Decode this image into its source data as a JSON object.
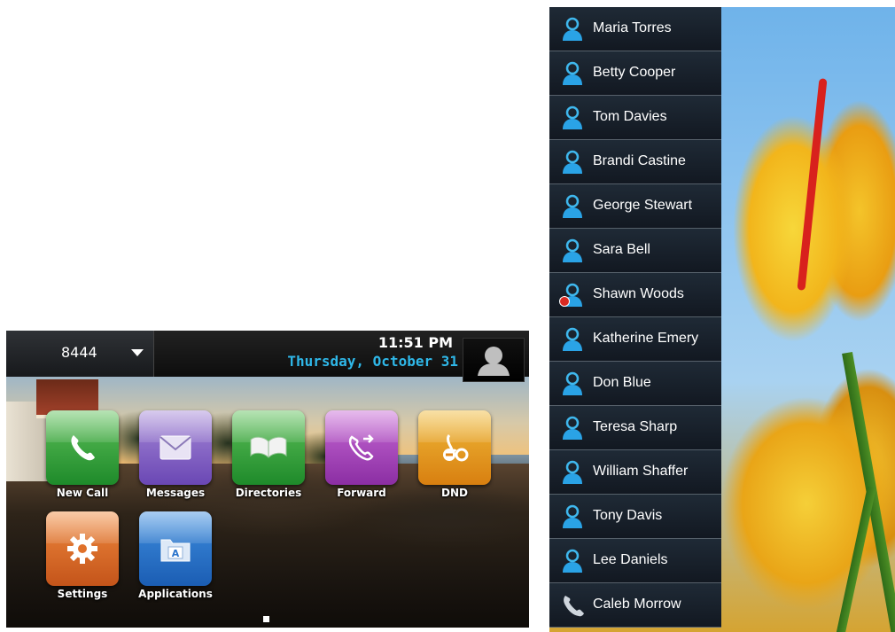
{
  "home": {
    "line": "8444",
    "time": "11:51 PM",
    "date": "Thursday, October 31",
    "apps": [
      {
        "label": "New Call",
        "icon": "phone-icon",
        "color": "#2e9b35"
      },
      {
        "label": "Messages",
        "icon": "envelope-icon",
        "color": "#7f5cc4"
      },
      {
        "label": "Directories",
        "icon": "book-icon",
        "color": "#2e9b35"
      },
      {
        "label": "Forward",
        "icon": "forward-call-icon",
        "color": "#a640bb"
      },
      {
        "label": "DND",
        "icon": "do-not-disturb-icon",
        "color": "#e29a1d"
      },
      {
        "label": "Settings",
        "icon": "gear-icon",
        "color": "#d96a27"
      },
      {
        "label": "Applications",
        "icon": "applications-icon",
        "color": "#2a74cc"
      }
    ]
  },
  "contacts": [
    {
      "name": "Maria Torres",
      "icon": "person-icon"
    },
    {
      "name": "Betty Cooper",
      "icon": "person-icon"
    },
    {
      "name": "Tom Davies",
      "icon": "person-icon"
    },
    {
      "name": "Brandi Castine",
      "icon": "person-icon"
    },
    {
      "name": "George Stewart",
      "icon": "person-icon"
    },
    {
      "name": "Sara Bell",
      "icon": "person-icon"
    },
    {
      "name": "Shawn Woods",
      "icon": "person-dnd-icon"
    },
    {
      "name": "Katherine Emery",
      "icon": "person-icon"
    },
    {
      "name": "Don Blue",
      "icon": "person-icon"
    },
    {
      "name": "Teresa Sharp",
      "icon": "person-icon"
    },
    {
      "name": "William Shaffer",
      "icon": "person-icon"
    },
    {
      "name": "Tony Davis",
      "icon": "person-icon"
    },
    {
      "name": "Lee Daniels",
      "icon": "person-icon"
    },
    {
      "name": "Caleb Morrow",
      "icon": "handset-icon"
    }
  ]
}
